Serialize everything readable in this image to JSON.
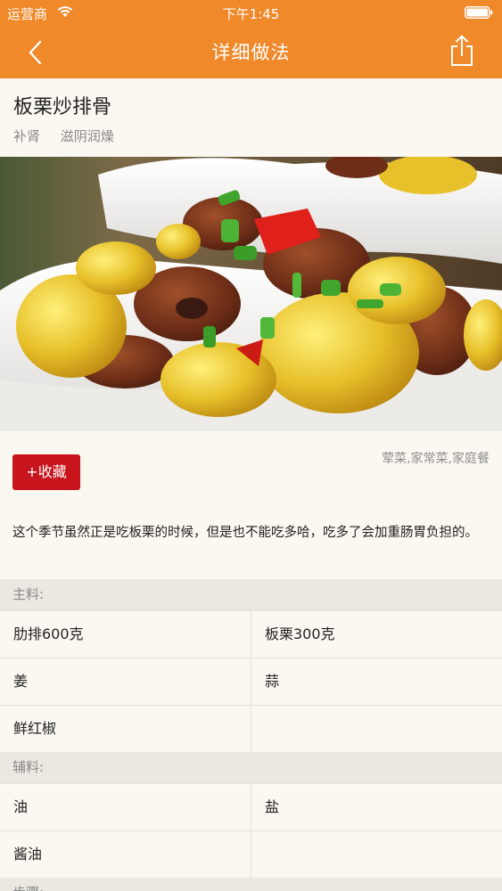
{
  "status_bar": {
    "carrier": "运营商",
    "time": "下午1:45"
  },
  "nav": {
    "title": "详细做法"
  },
  "recipe": {
    "title": "板栗炒排骨",
    "tags": [
      "补肾",
      "滋阴润燥"
    ],
    "collect_label": "+收藏",
    "categories": "荤菜,家常菜,家庭餐",
    "description": "这个季节虽然正是吃板栗的时候，但是也不能吃多哈，吃多了会加重肠胃负担的。"
  },
  "main_ingredients": {
    "label": "主料:",
    "rows": [
      [
        "肋排600克",
        "板栗300克"
      ],
      [
        "姜",
        "蒜"
      ],
      [
        "鲜红椒",
        ""
      ]
    ]
  },
  "secondary_ingredients": {
    "label": "辅料:",
    "rows": [
      [
        "油",
        "盐"
      ],
      [
        "酱油",
        ""
      ]
    ]
  },
  "steps": {
    "label": "步骤:"
  },
  "colors": {
    "nav_orange": "#f0892a",
    "collect_red": "#c8141c",
    "page_bg": "#fbf8f1",
    "section_bg": "#ebe8e1"
  }
}
